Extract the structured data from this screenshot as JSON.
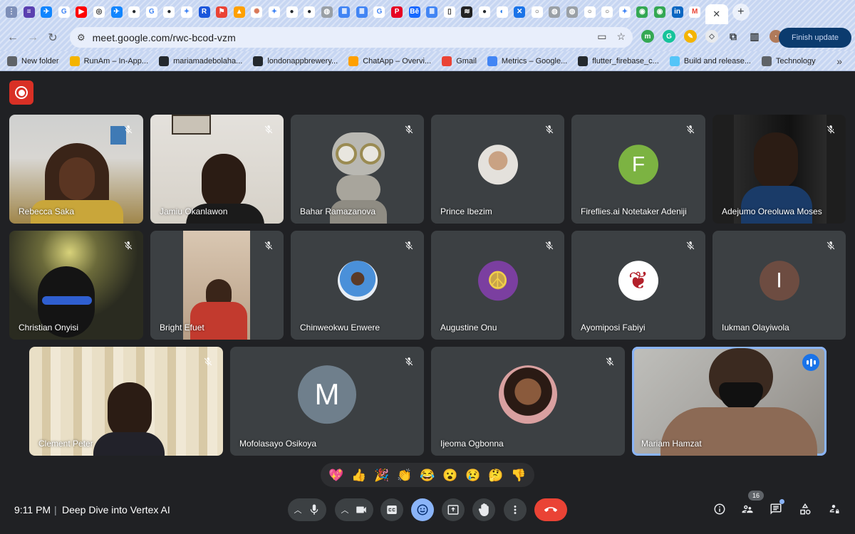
{
  "browser": {
    "url": "meet.google.com/rwc-bcod-vzm",
    "profile_label": "Finish update",
    "bookmarks": [
      {
        "label": "New folder",
        "icon": "folder-icon",
        "color": "#5f6368"
      },
      {
        "label": "RunAm – In-App...",
        "icon": "runam-icon",
        "color": "#f4b400"
      },
      {
        "label": "mariamadebolaha...",
        "icon": "github-icon",
        "color": "#24292e"
      },
      {
        "label": "londonappbrewery...",
        "icon": "github-icon",
        "color": "#24292e"
      },
      {
        "label": "ChatApp – Overvi...",
        "icon": "firebase-icon",
        "color": "#ffa000"
      },
      {
        "label": "Gmail",
        "icon": "gmail-icon",
        "color": "#ea4335"
      },
      {
        "label": "Metrics – Google...",
        "icon": "metrics-icon",
        "color": "#4285f4"
      },
      {
        "label": "flutter_firebase_c...",
        "icon": "github-icon",
        "color": "#24292e"
      },
      {
        "label": "Build and release...",
        "icon": "flutter-icon",
        "color": "#54c5f8"
      },
      {
        "label": "Technology",
        "icon": "globe-icon",
        "color": "#5f6368"
      }
    ]
  },
  "meeting": {
    "time": "9:11 PM",
    "separator": "|",
    "title": "Deep Dive into Vertex AI",
    "participant_count": "16",
    "accent": "#8ab4f8",
    "end_call_color": "#ea4335"
  },
  "participants": [
    {
      "name": "Rebecca Saka"
    },
    {
      "name": "Jamiu Okanlawon"
    },
    {
      "name": "Bahar Ramazanova"
    },
    {
      "name": "Prince Ibezim"
    },
    {
      "name": "Fireflies.ai Notetaker Adeniji",
      "initial": "F"
    },
    {
      "name": "Adejumo Oreoluwa Moses"
    },
    {
      "name": "Christian Onyisi"
    },
    {
      "name": "Bright Efuet"
    },
    {
      "name": "Chinweokwu Enwere"
    },
    {
      "name": "Augustine Onu"
    },
    {
      "name": "Ayomiposi Fabiyi"
    },
    {
      "name": "Iukman Olayiwola",
      "initial": "I"
    },
    {
      "name": "Clement Peter"
    },
    {
      "name": "Mofolasayo Osikoya",
      "initial": "M"
    },
    {
      "name": "Ijeoma Ogbonna"
    },
    {
      "name": "Mariam Hamzat"
    }
  ],
  "reactions": [
    "💖",
    "👍",
    "🎉",
    "👏",
    "😂",
    "😮",
    "😢",
    "🤔",
    "👎"
  ]
}
